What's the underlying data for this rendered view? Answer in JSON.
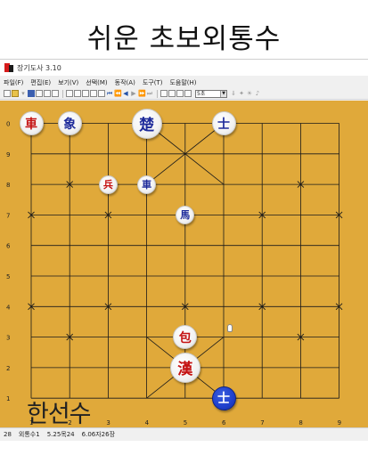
{
  "headline": "쉬운 초보외통수",
  "window": {
    "title": "장기도사 3.10"
  },
  "menu": [
    "파일(F)",
    "편집(E)",
    "보기(V)",
    "선택(M)",
    "동작(A)",
    "도구(T)",
    "도움말(H)"
  ],
  "toolbar": {
    "combo_value": "5초"
  },
  "board": {
    "left_labels": [
      "0",
      "9",
      "8",
      "7",
      "6",
      "5",
      "4",
      "3",
      "2",
      "1"
    ],
    "bottom_labels": [
      "1",
      "2",
      "3",
      "4",
      "5",
      "6",
      "7",
      "8",
      "9"
    ],
    "pieces": [
      {
        "id": "han-cha",
        "side": "han",
        "char": "車",
        "col": 0,
        "row": 0,
        "size": "small",
        "fill": "white",
        "icon": "han-chariot-piece"
      },
      {
        "id": "cho-sang",
        "side": "cho",
        "char": "象",
        "col": 1,
        "row": 0,
        "size": "small",
        "fill": "white",
        "icon": "cho-elephant-piece"
      },
      {
        "id": "cho-gung",
        "side": "cho",
        "char": "楚",
        "col": 3,
        "row": 0,
        "size": "large",
        "fill": "white",
        "icon": "cho-general-piece"
      },
      {
        "id": "cho-sa",
        "side": "cho",
        "char": "士",
        "col": 5,
        "row": 0,
        "size": "small",
        "fill": "white",
        "icon": "cho-advisor-piece"
      },
      {
        "id": "han-byeong",
        "side": "han",
        "char": "兵",
        "col": 2,
        "row": 2,
        "size": "tiny",
        "fill": "white",
        "icon": "han-soldier-piece"
      },
      {
        "id": "cho-cha",
        "side": "cho",
        "char": "車",
        "col": 3,
        "row": 2,
        "size": "tiny",
        "fill": "white",
        "icon": "cho-chariot-piece"
      },
      {
        "id": "cho-ma",
        "side": "cho",
        "char": "馬",
        "col": 4,
        "row": 3,
        "size": "tiny",
        "fill": "white",
        "icon": "cho-horse-piece"
      },
      {
        "id": "han-po",
        "side": "han",
        "char": "包",
        "col": 4,
        "row": 7,
        "size": "small",
        "fill": "white",
        "icon": "han-cannon-piece"
      },
      {
        "id": "han-gung",
        "side": "han",
        "char": "漢",
        "col": 4,
        "row": 8,
        "size": "large",
        "fill": "white",
        "icon": "han-general-piece"
      },
      {
        "id": "cho-sa-2",
        "side": "cho",
        "char": "士",
        "col": 5,
        "row": 9,
        "size": "small",
        "fill": "blue",
        "icon": "cho-advisor-selected-piece"
      }
    ]
  },
  "overlay_text": "한선수",
  "status": {
    "move": "28",
    "title": "외통수1",
    "score": "5.25목24",
    "time": "6.06자26장"
  },
  "colors": {
    "board": "#e0a93a",
    "line": "#1a1a1a",
    "han": "#c41212",
    "cho": "#1d2a9a",
    "selected": "#1f3fcc"
  }
}
